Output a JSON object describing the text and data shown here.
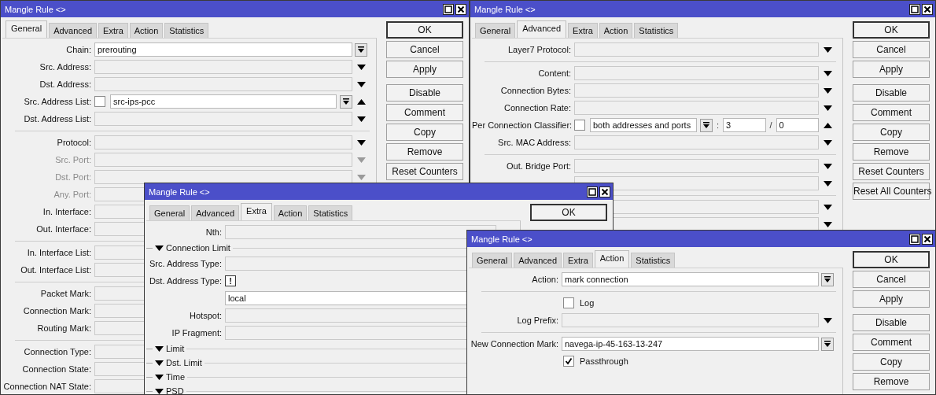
{
  "windows": [
    {
      "title": "Mangle Rule <>",
      "tabs": [
        {
          "label": "General",
          "selected": true
        },
        {
          "label": "Advanced",
          "selected": false
        },
        {
          "label": "Extra",
          "selected": false
        },
        {
          "label": "Action",
          "selected": false
        },
        {
          "label": "Statistics",
          "selected": false
        }
      ],
      "rows": [
        {
          "kind": "field",
          "label": "Chain:",
          "disabled": false,
          "input": {
            "filled": true,
            "value": "prerouting"
          },
          "arrow": {
            "kind": "combo"
          }
        },
        {
          "kind": "field",
          "label": "Src. Address:",
          "disabled": false,
          "input": {
            "filled": false
          },
          "arrow": {
            "kind": "down"
          }
        },
        {
          "kind": "field",
          "label": "Dst. Address:",
          "disabled": false,
          "input": {
            "filled": false
          },
          "arrow": {
            "kind": "down"
          }
        },
        {
          "kind": "field",
          "label": "Src. Address List:",
          "disabled": false,
          "invert": {
            "checked": false
          },
          "input": {
            "filled": true,
            "value": "src-ips-pcc",
            "combo": true
          },
          "arrow": {
            "kind": "up"
          }
        },
        {
          "kind": "field",
          "label": "Dst. Address List:",
          "disabled": false,
          "input": {
            "filled": false
          },
          "arrow": {
            "kind": "down"
          }
        },
        {
          "kind": "divider"
        },
        {
          "kind": "field",
          "label": "Protocol:",
          "disabled": false,
          "input": {
            "filled": false
          },
          "arrow": {
            "kind": "down"
          }
        },
        {
          "kind": "field",
          "label": "Src. Port:",
          "disabled": true,
          "input": {
            "filled": false
          },
          "arrow": {
            "kind": "down"
          }
        },
        {
          "kind": "field",
          "label": "Dst. Port:",
          "disabled": true,
          "input": {
            "filled": false
          },
          "arrow": {
            "kind": "down"
          }
        },
        {
          "kind": "field",
          "label": "Any. Port:",
          "disabled": true,
          "input": {
            "filled": false
          }
        },
        {
          "kind": "field",
          "label": "In. Interface:",
          "disabled": false,
          "input": {
            "filled": false
          }
        },
        {
          "kind": "field",
          "label": "Out. Interface:",
          "disabled": false,
          "input": {
            "filled": false
          }
        },
        {
          "kind": "divider"
        },
        {
          "kind": "field",
          "label": "In. Interface List:",
          "disabled": false,
          "input": {
            "filled": false
          }
        },
        {
          "kind": "field",
          "label": "Out. Interface List:",
          "disabled": false,
          "input": {
            "filled": false
          }
        },
        {
          "kind": "divider"
        },
        {
          "kind": "field",
          "label": "Packet Mark:",
          "disabled": false,
          "input": {
            "filled": false
          }
        },
        {
          "kind": "field",
          "label": "Connection Mark:",
          "disabled": false,
          "input": {
            "filled": false
          }
        },
        {
          "kind": "field",
          "label": "Routing Mark:",
          "disabled": false,
          "input": {
            "filled": false
          }
        },
        {
          "kind": "divider"
        },
        {
          "kind": "field",
          "label": "Connection Type:",
          "disabled": false,
          "input": {
            "filled": false
          }
        },
        {
          "kind": "field",
          "label": "Connection State:",
          "disabled": false,
          "input": {
            "filled": false
          }
        },
        {
          "kind": "field",
          "label": "Connection NAT State:",
          "disabled": false,
          "input": {
            "filled": false
          }
        }
      ],
      "button_groups": [
        {
          "buttons": [
            {
              "label": "OK",
              "default": true
            },
            {
              "label": "Cancel",
              "default": false
            },
            {
              "label": "Apply",
              "default": false
            }
          ]
        },
        {
          "buttons": [
            {
              "label": "Disable",
              "default": false
            },
            {
              "label": "Comment",
              "default": false
            },
            {
              "label": "Copy",
              "default": false
            },
            {
              "label": "Remove",
              "default": false
            },
            {
              "label": "Reset Counters",
              "default": false
            }
          ]
        }
      ]
    },
    {
      "title": "Mangle Rule <>",
      "tabs": [
        {
          "label": "General",
          "selected": false
        },
        {
          "label": "Advanced",
          "selected": true
        },
        {
          "label": "Extra",
          "selected": false
        },
        {
          "label": "Action",
          "selected": false
        },
        {
          "label": "Statistics",
          "selected": false
        }
      ],
      "rows": [
        {
          "kind": "field",
          "label": "Layer7 Protocol:",
          "input": {
            "filled": false
          },
          "arrow": {
            "kind": "down"
          }
        },
        {
          "kind": "divider"
        },
        {
          "kind": "field",
          "label": "Content:",
          "input": {
            "filled": false
          },
          "arrow": {
            "kind": "down"
          }
        },
        {
          "kind": "field",
          "label": "Connection Bytes:",
          "input": {
            "filled": false
          },
          "arrow": {
            "kind": "down"
          }
        },
        {
          "kind": "field",
          "label": "Connection Rate:",
          "input": {
            "filled": false
          },
          "arrow": {
            "kind": "down"
          }
        },
        {
          "kind": "pcc",
          "label": "Per Connection Classifier:",
          "invert": {
            "checked": false
          },
          "value": "both addresses and ports",
          "sep1": ":",
          "first": "3",
          "sep2": "/",
          "second": "0",
          "arrow": {
            "kind": "up"
          }
        },
        {
          "kind": "field",
          "label": "Src. MAC Address:",
          "input": {
            "filled": false
          },
          "arrow": {
            "kind": "down"
          }
        },
        {
          "kind": "divider"
        },
        {
          "kind": "field",
          "label": "Out. Bridge Port:",
          "input": {
            "filled": false
          },
          "arrow": {
            "kind": "down"
          }
        },
        {
          "kind": "field",
          "input": {
            "filled": false
          },
          "arrow": {
            "kind": "down"
          }
        },
        {
          "kind": "divider"
        },
        {
          "kind": "field",
          "input": {
            "filled": false
          },
          "arrow": {
            "kind": "down"
          }
        },
        {
          "kind": "field",
          "input": {
            "filled": false
          },
          "arrow": {
            "kind": "down"
          }
        }
      ],
      "button_groups": [
        {
          "buttons": [
            {
              "label": "OK",
              "default": true
            },
            {
              "label": "Cancel",
              "default": false
            },
            {
              "label": "Apply",
              "default": false
            }
          ]
        },
        {
          "buttons": [
            {
              "label": "Disable",
              "default": false
            },
            {
              "label": "Comment",
              "default": false
            },
            {
              "label": "Copy",
              "default": false
            },
            {
              "label": "Remove",
              "default": false
            },
            {
              "label": "Reset Counters",
              "default": false
            },
            {
              "label": "Reset All Counters",
              "default": false
            }
          ]
        }
      ]
    },
    {
      "title": "Mangle Rule <>",
      "tabs": [
        {
          "label": "General",
          "selected": false
        },
        {
          "label": "Advanced",
          "selected": false
        },
        {
          "label": "Extra",
          "selected": true
        },
        {
          "label": "Action",
          "selected": false
        },
        {
          "label": "Statistics",
          "selected": false
        }
      ],
      "rows": [
        {
          "kind": "field",
          "label": "Nth:",
          "input": {
            "filled": false
          }
        },
        {
          "kind": "section",
          "label": "Connection Limit"
        },
        {
          "kind": "field",
          "label": "Src. Address Type:",
          "input": {
            "filled": false
          }
        },
        {
          "kind": "field",
          "label": "Dst. Address Type:",
          "invert": {
            "checked": true,
            "mark": "!"
          }
        },
        {
          "kind": "field",
          "input": {
            "filled": true,
            "value": "local"
          }
        },
        {
          "kind": "field",
          "label": "Hotspot:",
          "input": {
            "filled": false
          }
        },
        {
          "kind": "field",
          "label": "IP Fragment:",
          "input": {
            "filled": false
          }
        },
        {
          "kind": "section",
          "label": "Limit"
        },
        {
          "kind": "section",
          "label": "Dst. Limit"
        },
        {
          "kind": "section",
          "label": "Time"
        },
        {
          "kind": "section",
          "label": "PSD"
        }
      ],
      "button_groups": [
        {
          "buttons": [
            {
              "label": "OK",
              "default": true
            }
          ]
        }
      ]
    },
    {
      "title": "Mangle Rule <>",
      "tabs": [
        {
          "label": "General",
          "selected": false
        },
        {
          "label": "Advanced",
          "selected": false
        },
        {
          "label": "Extra",
          "selected": false
        },
        {
          "label": "Action",
          "selected": true
        },
        {
          "label": "Statistics",
          "selected": false
        }
      ],
      "rows": [
        {
          "kind": "field",
          "label": "Action:",
          "input": {
            "filled": true,
            "value": "mark connection"
          },
          "arrow": {
            "kind": "combo"
          }
        },
        {
          "kind": "divider"
        },
        {
          "kind": "check",
          "label": "Log",
          "checked": false
        },
        {
          "kind": "field",
          "label": "Log Prefix:",
          "input": {
            "filled": false
          },
          "arrow": {
            "kind": "down"
          }
        },
        {
          "kind": "divider"
        },
        {
          "kind": "field",
          "label": "New Connection Mark:",
          "input": {
            "filled": true,
            "value": "navega-ip-45-163-13-247"
          },
          "arrow": {
            "kind": "combo"
          }
        },
        {
          "kind": "check",
          "label": "Passthrough",
          "checked": true
        }
      ],
      "button_groups": [
        {
          "buttons": [
            {
              "label": "OK",
              "default": true
            },
            {
              "label": "Cancel",
              "default": false
            },
            {
              "label": "Apply",
              "default": false
            }
          ]
        },
        {
          "buttons": [
            {
              "label": "Disable",
              "default": false
            },
            {
              "label": "Comment",
              "default": false
            },
            {
              "label": "Copy",
              "default": false
            },
            {
              "label": "Remove",
              "default": false
            }
          ]
        }
      ]
    }
  ]
}
